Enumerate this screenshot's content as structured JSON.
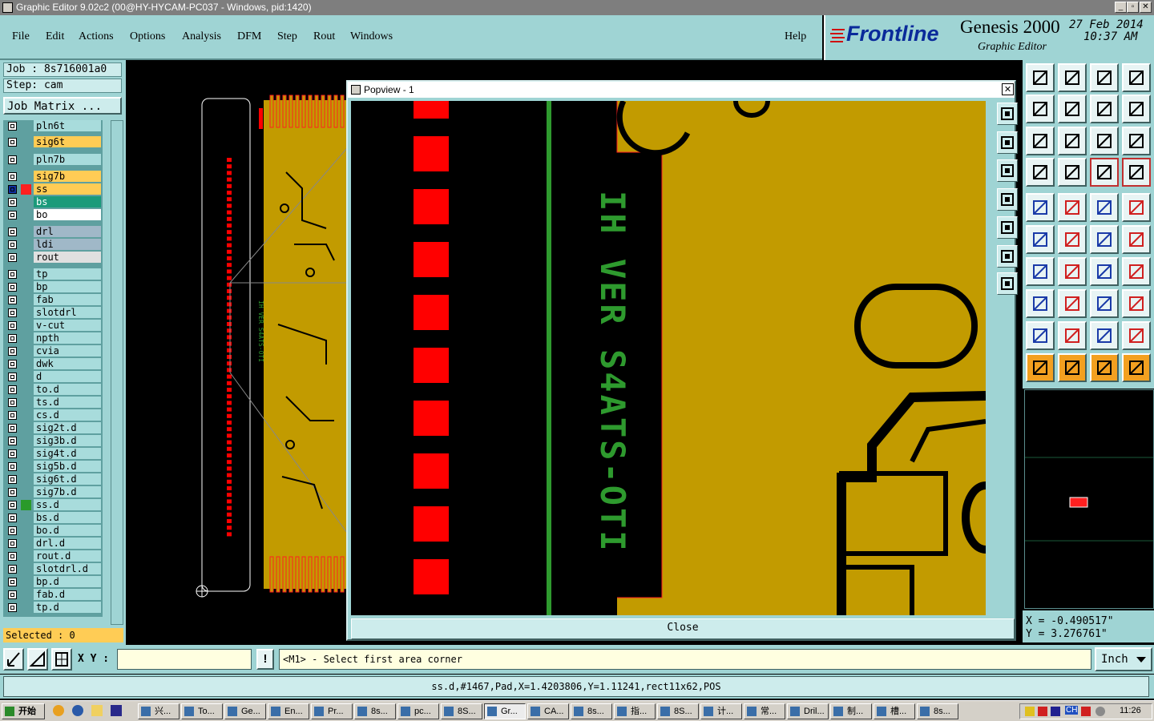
{
  "window": {
    "title": "Graphic Editor 9.02c2 (00@HY-HYCAM-PC037 - Windows, pid:1420)",
    "min_label": "_",
    "max_label": "▫",
    "close_label": "✕"
  },
  "menu": {
    "items": [
      "File",
      "Edit",
      "Actions",
      "Options",
      "Analysis",
      "DFM",
      "Step",
      "Rout",
      "Windows"
    ],
    "help": "Help"
  },
  "brand": {
    "logo": "Frontline",
    "product": "Genesis 2000",
    "subtitle": "Graphic Editor",
    "date": "27 Feb 2014",
    "time": "10:37 AM"
  },
  "job": {
    "job_label": "Job : 8s716001a0",
    "step_label": "Step: cam",
    "matrix_button": "Job Matrix ..."
  },
  "layers": [
    {
      "name": "pln6t",
      "color": "#a8dcdc",
      "mark": ""
    },
    {
      "name": "sig6t",
      "color": "#ffcc55",
      "mark": ""
    },
    {
      "name": "pln7b",
      "color": "#a8dcdc",
      "mark": ""
    },
    {
      "name": "sig7b",
      "color": "#ffcc55",
      "mark": ""
    },
    {
      "name": "ss",
      "color": "#ffcc55",
      "mark": "⊞"
    },
    {
      "name": "bs",
      "color": "#1a9a7a",
      "mark": ""
    },
    {
      "name": "bo",
      "color": "#ffffff",
      "mark": "⬋"
    },
    {
      "name": "drl",
      "color": "#a0b8c8",
      "mark": ""
    },
    {
      "name": "ldi",
      "color": "#a0b8c8",
      "mark": ""
    },
    {
      "name": "rout",
      "color": "#e0e0e0",
      "mark": ""
    },
    {
      "name": "tp",
      "color": "#a8dcdc",
      "mark": ""
    },
    {
      "name": "bp",
      "color": "#a8dcdc",
      "mark": ""
    },
    {
      "name": "fab",
      "color": "#a8dcdc",
      "mark": "⬋"
    },
    {
      "name": "slotdrl",
      "color": "#a8dcdc",
      "mark": ""
    },
    {
      "name": "v-cut",
      "color": "#a8dcdc",
      "mark": ""
    },
    {
      "name": "npth",
      "color": "#a8dcdc",
      "mark": ""
    },
    {
      "name": "cvia",
      "color": "#a8dcdc",
      "mark": ""
    },
    {
      "name": "dwk",
      "color": "#a8dcdc",
      "mark": ""
    },
    {
      "name": "d",
      "color": "#a8dcdc",
      "mark": ""
    },
    {
      "name": "to.d",
      "color": "#a8dcdc",
      "mark": "⬋"
    },
    {
      "name": "ts.d",
      "color": "#a8dcdc",
      "mark": ""
    },
    {
      "name": "cs.d",
      "color": "#a8dcdc",
      "mark": ""
    },
    {
      "name": "sig2t.d",
      "color": "#a8dcdc",
      "mark": ""
    },
    {
      "name": "sig3b.d",
      "color": "#a8dcdc",
      "mark": ""
    },
    {
      "name": "sig4t.d",
      "color": "#a8dcdc",
      "mark": ""
    },
    {
      "name": "sig5b.d",
      "color": "#a8dcdc",
      "mark": ""
    },
    {
      "name": "sig6t.d",
      "color": "#a8dcdc",
      "mark": ""
    },
    {
      "name": "sig7b.d",
      "color": "#a8dcdc",
      "mark": ""
    },
    {
      "name": "ss.d",
      "color": "#a8dcdc",
      "mark": ""
    },
    {
      "name": "bs.d",
      "color": "#a8dcdc",
      "mark": ""
    },
    {
      "name": "bo.d",
      "color": "#a8dcdc",
      "mark": "⬋"
    },
    {
      "name": "drl.d",
      "color": "#a8dcdc",
      "mark": ""
    },
    {
      "name": "rout.d",
      "color": "#a8dcdc",
      "mark": ""
    },
    {
      "name": "slotdrl.d",
      "color": "#a8dcdc",
      "mark": ""
    },
    {
      "name": "bp.d",
      "color": "#a8dcdc",
      "mark": ""
    },
    {
      "name": "fab.d",
      "color": "#a8dcdc",
      "mark": "⬋"
    },
    {
      "name": "tp.d",
      "color": "#a8dcdc",
      "mark": ""
    }
  ],
  "selected_label": "Selected : 0",
  "popview": {
    "title": "Popview - 1",
    "close_button": "Close",
    "board_text": "IH VER S4ATS-OTI",
    "close_x": "✕"
  },
  "board": {
    "silkscreen_text": "IH VER S4ATS-OTI"
  },
  "coords": {
    "x": "X = -0.490517\"",
    "y": "Y = 3.276761\""
  },
  "command": {
    "xy_label": "X Y :",
    "xy_value": "",
    "prompt": "<M1> - Select first area corner",
    "units": "Inch",
    "info_icon": "!"
  },
  "status": {
    "text": "ss.d,#1467,Pad,X=1.4203806,Y=1.11241,rect11x62,POS"
  },
  "taskbar": {
    "start": "开始",
    "tasks": [
      "兴...",
      "To...",
      "Ge...",
      "En...",
      "Pr...",
      "8s...",
      "pc...",
      "8S...",
      "Gr...",
      "CA...",
      "8s...",
      "指...",
      "8S...",
      "计...",
      "常...",
      "Dril...",
      "制...",
      "槽...",
      "8s..."
    ],
    "ime": "CH",
    "clock": "11:26"
  },
  "colors": {
    "panel": "#9fd4d4",
    "copper": "#c29b00",
    "pad_red": "#ff0000",
    "silk_green": "#2e9a2e"
  }
}
